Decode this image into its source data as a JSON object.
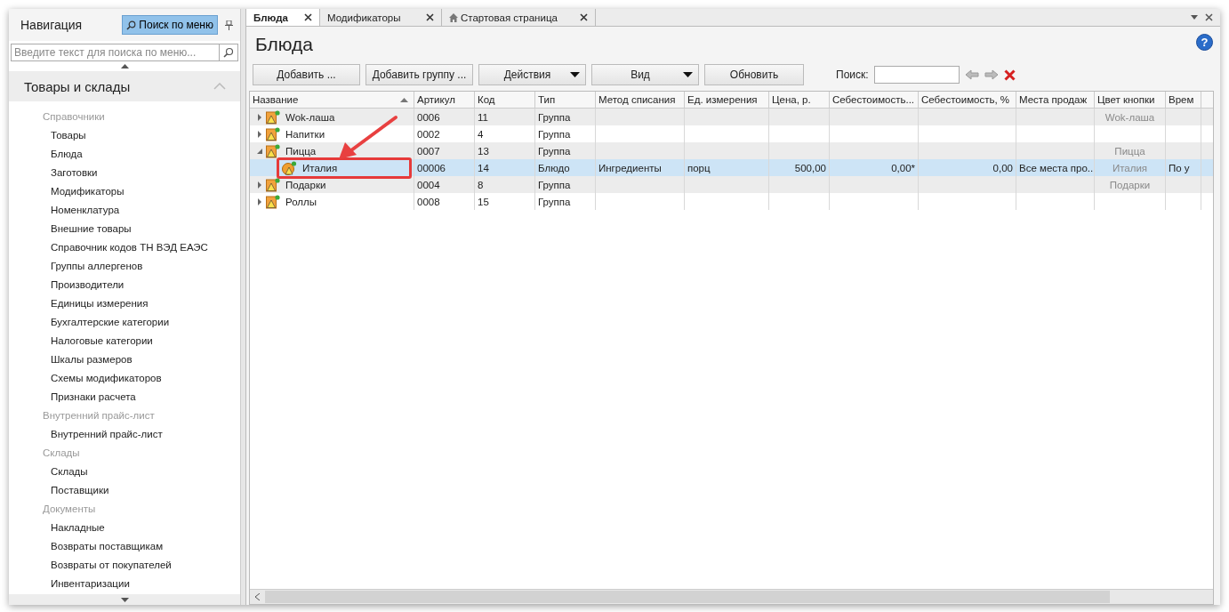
{
  "navigation": {
    "title": "Навигация",
    "menu_search_button": "Поиск по меню",
    "search": {
      "placeholder": "Введите текст для поиска по меню..."
    },
    "section": {
      "title": "Товары и склады",
      "expanded": true
    },
    "groups": [
      {
        "title": "Справочники",
        "items": [
          "Товары",
          "Блюда",
          "Заготовки",
          "Модификаторы",
          "Номенклатура",
          "Внешние товары",
          "Справочник кодов ТН ВЭД ЕАЭС",
          "Группы аллергенов",
          "Производители",
          "Единицы измерения",
          "Бухгалтерские категории",
          "Налоговые категории",
          "Шкалы размеров",
          "Схемы модификаторов",
          "Признаки расчета"
        ]
      },
      {
        "title": "Внутренний прайс-лист",
        "items": [
          "Внутренний прайс-лист"
        ]
      },
      {
        "title": "Склады",
        "items": [
          "Склады",
          "Поставщики"
        ]
      },
      {
        "title": "Документы",
        "items": [
          "Накладные",
          "Возвраты поставщикам",
          "Возвраты от покупателей",
          "Инвентаризации"
        ]
      }
    ]
  },
  "tabs": [
    {
      "label": "Блюда",
      "selected": true,
      "kind": "plain"
    },
    {
      "label": "Модификаторы",
      "selected": false,
      "kind": "plain"
    },
    {
      "label": "Стартовая страница",
      "selected": false,
      "kind": "home"
    }
  ],
  "page": {
    "title": "Блюда",
    "buttons": [
      {
        "label": "Добавить ...",
        "kind": "plain"
      },
      {
        "label": "Добавить группу ...",
        "kind": "plain"
      },
      {
        "label": "Действия",
        "kind": "dropdown"
      },
      {
        "label": "Вид",
        "kind": "dropdown"
      },
      {
        "label": "Обновить",
        "kind": "plain"
      }
    ],
    "search_label": "Поиск:",
    "help": "?"
  },
  "table": {
    "columns": [
      "Название",
      "Артикул",
      "Код",
      "Тип",
      "Метод списания",
      "Ед. измерения",
      "Цена, р.",
      "Себестоимость...",
      "Себестоимость, %",
      "Места продаж",
      "Цвет кнопки",
      "Врем"
    ],
    "rows": [
      {
        "kind": "group",
        "name": "Wok-лаша",
        "article": "0006",
        "code": "11",
        "type": "Группа",
        "button_color": "Wok-лаша",
        "expanded": false,
        "selected": false
      },
      {
        "kind": "group",
        "name": "Напитки",
        "article": "0002",
        "code": "4",
        "type": "Группа",
        "expanded": false,
        "selected": false
      },
      {
        "kind": "group",
        "name": "Пицца",
        "article": "0007",
        "code": "13",
        "type": "Группа",
        "button_color": "Пицца",
        "expanded": true,
        "selected": false,
        "children": [
          {
            "kind": "dish",
            "name": "Италия",
            "article": "00006",
            "code": "14",
            "type": "Блюдо",
            "method": "Ингредиенты",
            "unit": "порц",
            "price": "500,00",
            "cost": "0,00*",
            "cost_pct": "0,00",
            "places": "Все места про...",
            "button_color": "Италия",
            "time": "По у",
            "selected": true,
            "highlighted": true
          }
        ]
      },
      {
        "kind": "group",
        "name": "Подарки",
        "article": "0004",
        "code": "8",
        "type": "Группа",
        "button_color": "Подарки",
        "expanded": false,
        "selected": false
      },
      {
        "kind": "group",
        "name": "Роллы",
        "article": "0008",
        "code": "15",
        "type": "Группа",
        "expanded": false,
        "selected": false
      }
    ]
  }
}
